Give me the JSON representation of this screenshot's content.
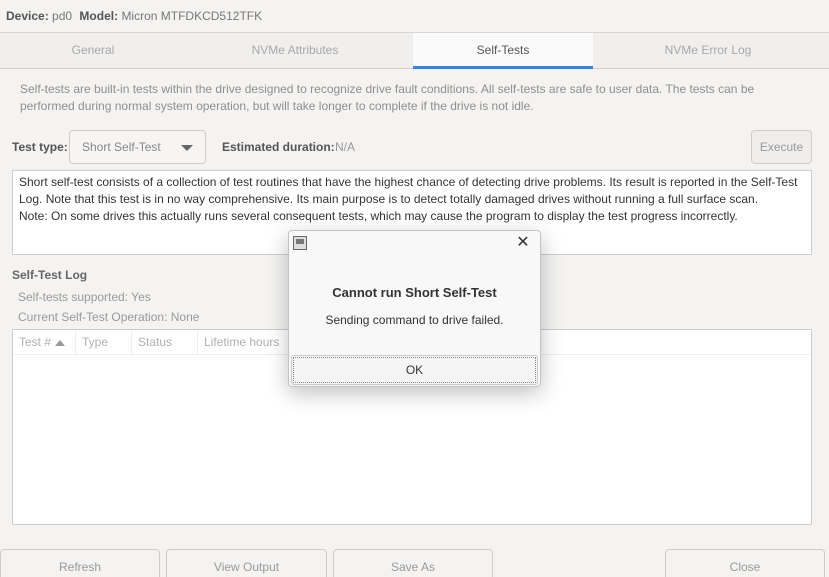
{
  "header": {
    "device_label": "Device:",
    "device_value": "pd0",
    "model_label": "Model:",
    "model_value": "Micron MTFDKCD512TFK"
  },
  "tabs": [
    {
      "label": "General"
    },
    {
      "label": "NVMe Attributes"
    },
    {
      "label": "Self-Tests"
    },
    {
      "label": "NVMe Error Log"
    }
  ],
  "active_tab": "Self-Tests",
  "intro_text": "Self-tests are built-in tests within the drive designed to recognize drive fault conditions. All self-tests are safe to user data. The tests can be performed during normal system operation, but will take longer to complete if the drive is not idle.",
  "test_controls": {
    "test_type_label": "Test type:",
    "test_type_value": "Short Self-Test",
    "duration_label": "Estimated duration:",
    "duration_value": "N/A",
    "execute_label": "Execute"
  },
  "description": "Short self-test consists of a collection of test routines that have the highest chance of detecting drive problems. Its result is reported in the Self-Test Log. Note that this test is in no way comprehensive. Its main purpose is to detect totally damaged drives without running a full surface scan.\nNote: On some drives this actually runs several consequent tests, which may cause the program to display the test progress incorrectly.",
  "log": {
    "title": "Self-Test Log",
    "supported": "Self-tests supported: Yes",
    "current_op": "Current Self-Test Operation: None",
    "columns": [
      "Test #",
      "Type",
      "Status",
      "Lifetime hours"
    ]
  },
  "buttons": {
    "refresh": "Refresh",
    "view_output": "View Output",
    "save_as": "Save As",
    "close": "Close"
  },
  "dialog": {
    "title": "Cannot run Short Self-Test",
    "message": "Sending command to drive failed.",
    "ok_label": "OK",
    "close_glyph": "✕"
  },
  "colors": {
    "accent": "#3584e4",
    "background": "#f4f3f2"
  }
}
